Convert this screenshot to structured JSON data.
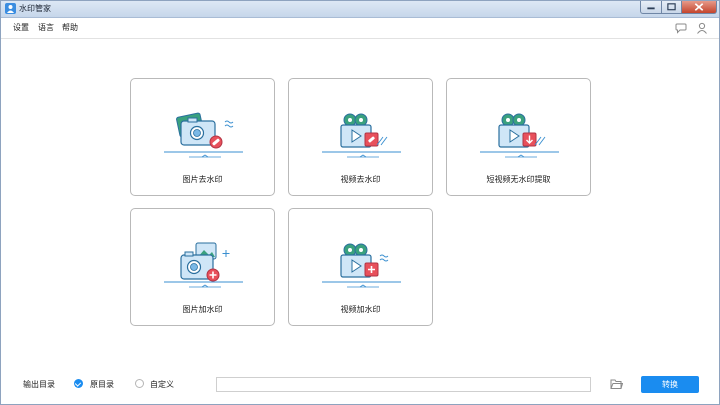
{
  "window": {
    "title": "水印管家"
  },
  "menu": {
    "items": [
      {
        "label": "设置"
      },
      {
        "label": "语言"
      },
      {
        "label": "帮助"
      }
    ]
  },
  "cards": [
    {
      "label": "图片去水印"
    },
    {
      "label": "视频去水印"
    },
    {
      "label": "短视频无水印提取"
    },
    {
      "label": "图片加水印"
    },
    {
      "label": "视频加水印"
    }
  ],
  "footer": {
    "output_label": "输出目录",
    "option_original": "原目录",
    "option_custom": "自定义",
    "selected_option": "原目录",
    "path_value": "",
    "convert_label": "转换"
  },
  "colors": {
    "accent": "#1a8cf0",
    "icon_line": "#3a8fd0",
    "icon_red": "#e8505b",
    "icon_green": "#3aa17e"
  },
  "icons": [
    "user-icon",
    "chat-icon",
    "minimize-icon",
    "maximize-icon",
    "close-icon",
    "folder-icon"
  ]
}
